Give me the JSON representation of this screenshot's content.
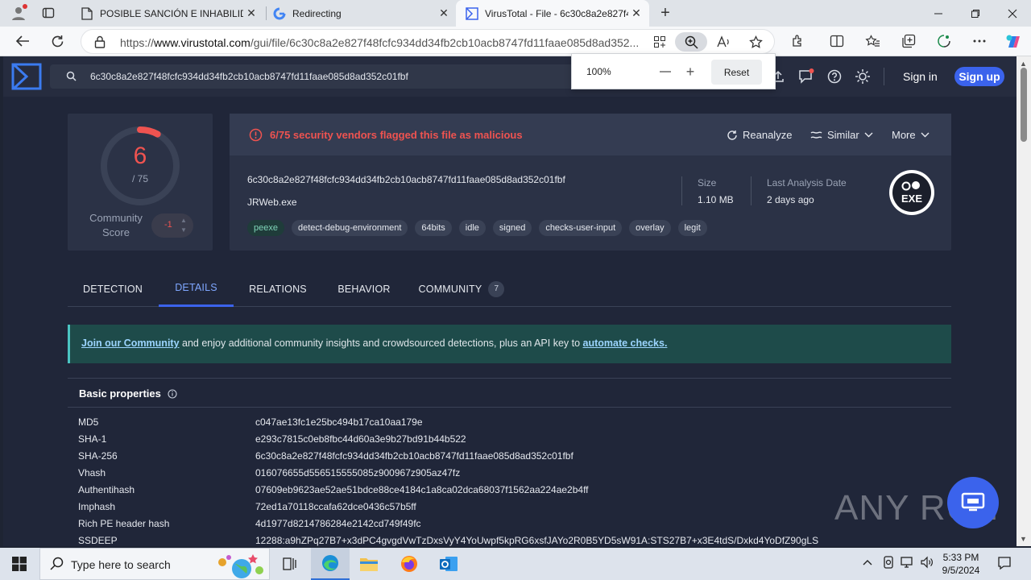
{
  "browser": {
    "tabs": [
      {
        "title": "POSIBLE SANCIÓN  E INHABILIDAD",
        "close": "✕"
      },
      {
        "title": "Redirecting",
        "close": "✕"
      },
      {
        "title": "VirusTotal - File - 6c30c8a2e827f4",
        "close": "✕"
      }
    ],
    "new_tab": "+",
    "url_prefix": "https://",
    "url_domain": "www.virustotal.com",
    "url_path": "/gui/file/6c30c8a2e827f48fcfc934dd34fb2cb10acb8747fd11faae085d8ad352...",
    "zoom": {
      "percent": "100%",
      "minus": "—",
      "plus": "+",
      "reset": "Reset"
    }
  },
  "vt": {
    "search_value": "6c30c8a2e827f48fcfc934dd34fb2cb10acb8747fd11faae085d8ad352c01fbf",
    "signin": "Sign in",
    "signup": "Sign up",
    "score": {
      "detections": "6",
      "total": "/ 75",
      "detection_ratio": 0.08
    },
    "community": {
      "label": "Community Score",
      "value": "-1"
    },
    "alert": "6/75 security vendors flagged this file as malicious",
    "actions": {
      "reanalyze": "Reanalyze",
      "similar": "Similar",
      "more": "More"
    },
    "file": {
      "hash": "6c30c8a2e827f48fcfc934dd34fb2cb10acb8747fd11faae085d8ad352c01fbf",
      "name": "JRWeb.exe",
      "size_label": "Size",
      "size_value": "1.10 MB",
      "date_label": "Last Analysis Date",
      "date_value": "2 days ago",
      "type_badge": "EXE"
    },
    "tags": [
      "peexe",
      "detect-debug-environment",
      "64bits",
      "idle",
      "signed",
      "checks-user-input",
      "overlay",
      "legit"
    ],
    "tabs": [
      {
        "label": "DETECTION"
      },
      {
        "label": "DETAILS"
      },
      {
        "label": "RELATIONS"
      },
      {
        "label": "BEHAVIOR"
      },
      {
        "label": "COMMUNITY",
        "count": "7"
      }
    ],
    "banner": {
      "link1": "Join our Community",
      "middle": " and enjoy additional community insights and crowdsourced detections, plus an API key to ",
      "link2": "automate checks."
    },
    "basic_properties": {
      "title": "Basic properties",
      "rows": [
        {
          "k": "MD5",
          "v": "c047ae13fc1e25bc494b17ca10aa179e"
        },
        {
          "k": "SHA-1",
          "v": "e293c7815c0eb8fbc44d60a3e9b27bd91b44b522"
        },
        {
          "k": "SHA-256",
          "v": "6c30c8a2e827f48fcfc934dd34fb2cb10acb8747fd11faae085d8ad352c01fbf"
        },
        {
          "k": "Vhash",
          "v": "016076655d556515555085z900967z905az47fz"
        },
        {
          "k": "Authentihash",
          "v": "07609eb9623ae52ae51bdce88ce4184c1a8ca02dca68037f1562aa224ae2b4ff"
        },
        {
          "k": "Imphash",
          "v": "72ed1a70118ccafa62dce0436c57b5ff"
        },
        {
          "k": "Rich PE header hash",
          "v": "4d1977d8214786284e2142cd749f49fc"
        },
        {
          "k": "SSDEEP",
          "v": "12288:a9hZPq27B7+x3dPC4gvgdVwTzDxsVyY4YoUwpf5kpRG6xsfJAYo2R0B5YD5sW91A:STS27B7+x3E4tdS/Dxkd4YoDfZ90gLS"
        }
      ]
    }
  },
  "watermark": "ANY RUN",
  "taskbar": {
    "search_placeholder": "Type here to search",
    "time": "5:33 PM",
    "date": "9/5/2024"
  },
  "colors": {
    "accent": "#3b63ec",
    "danger": "#ef5350",
    "banner": "#1e4b4a"
  }
}
